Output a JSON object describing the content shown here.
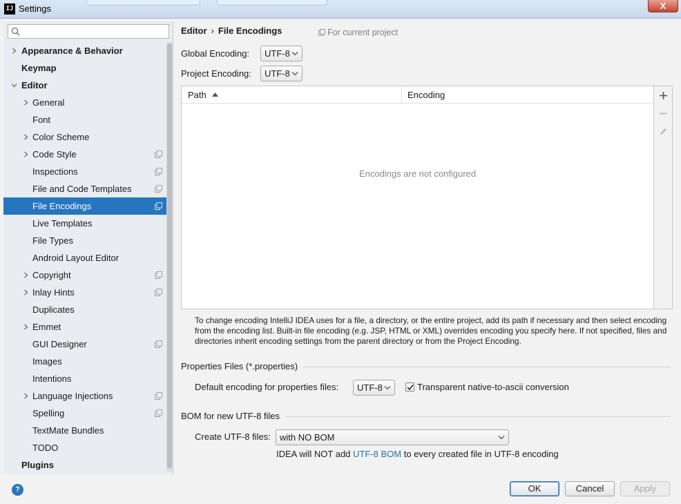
{
  "window": {
    "title": "Settings",
    "app_icon_text": "IJ",
    "close_glyph": "X"
  },
  "search": {
    "placeholder": ""
  },
  "tree": [
    {
      "label": "Appearance & Behavior",
      "level": 0,
      "arrow": "collapsed",
      "project": false,
      "selected": false
    },
    {
      "label": "Keymap",
      "level": 0,
      "arrow": "none",
      "project": false,
      "selected": false
    },
    {
      "label": "Editor",
      "level": 0,
      "arrow": "expanded",
      "project": false,
      "selected": false
    },
    {
      "label": "General",
      "level": 1,
      "arrow": "collapsed",
      "project": false,
      "selected": false
    },
    {
      "label": "Font",
      "level": 1,
      "arrow": "none",
      "project": false,
      "selected": false
    },
    {
      "label": "Color Scheme",
      "level": 1,
      "arrow": "collapsed",
      "project": false,
      "selected": false
    },
    {
      "label": "Code Style",
      "level": 1,
      "arrow": "collapsed",
      "project": true,
      "selected": false
    },
    {
      "label": "Inspections",
      "level": 1,
      "arrow": "none",
      "project": true,
      "selected": false
    },
    {
      "label": "File and Code Templates",
      "level": 1,
      "arrow": "none",
      "project": true,
      "selected": false
    },
    {
      "label": "File Encodings",
      "level": 1,
      "arrow": "none",
      "project": true,
      "selected": true
    },
    {
      "label": "Live Templates",
      "level": 1,
      "arrow": "none",
      "project": false,
      "selected": false
    },
    {
      "label": "File Types",
      "level": 1,
      "arrow": "none",
      "project": false,
      "selected": false
    },
    {
      "label": "Android Layout Editor",
      "level": 1,
      "arrow": "none",
      "project": false,
      "selected": false
    },
    {
      "label": "Copyright",
      "level": 1,
      "arrow": "collapsed",
      "project": true,
      "selected": false
    },
    {
      "label": "Inlay Hints",
      "level": 1,
      "arrow": "collapsed",
      "project": true,
      "selected": false
    },
    {
      "label": "Duplicates",
      "level": 1,
      "arrow": "none",
      "project": false,
      "selected": false
    },
    {
      "label": "Emmet",
      "level": 1,
      "arrow": "collapsed",
      "project": false,
      "selected": false
    },
    {
      "label": "GUI Designer",
      "level": 1,
      "arrow": "none",
      "project": true,
      "selected": false
    },
    {
      "label": "Images",
      "level": 1,
      "arrow": "none",
      "project": false,
      "selected": false
    },
    {
      "label": "Intentions",
      "level": 1,
      "arrow": "none",
      "project": false,
      "selected": false
    },
    {
      "label": "Language Injections",
      "level": 1,
      "arrow": "collapsed",
      "project": true,
      "selected": false
    },
    {
      "label": "Spelling",
      "level": 1,
      "arrow": "none",
      "project": true,
      "selected": false
    },
    {
      "label": "TextMate Bundles",
      "level": 1,
      "arrow": "none",
      "project": false,
      "selected": false
    },
    {
      "label": "TODO",
      "level": 1,
      "arrow": "none",
      "project": false,
      "selected": false
    },
    {
      "label": "Plugins",
      "level": 0,
      "arrow": "none",
      "project": false,
      "selected": false
    }
  ],
  "breadcrumb": {
    "parent": "Editor",
    "separator": "›",
    "current": "File Encodings"
  },
  "scope_note": "For current project",
  "global_encoding": {
    "label": "Global Encoding:",
    "value": "UTF-8"
  },
  "project_encoding": {
    "label": "Project Encoding:",
    "value": "UTF-8"
  },
  "table": {
    "columns": [
      "Path",
      "Encoding"
    ],
    "sort_column": "Path",
    "sort_direction": "ascending",
    "empty_text": "Encodings are not configured",
    "rows": []
  },
  "help_text": "To change encoding IntelliJ IDEA uses for a file, a directory, or the entire project, add its path if necessary and then select encoding from the encoding list. Built-in file encoding (e.g. JSP, HTML or XML) overrides encoding you specify here. If not specified, files and directories inherit encoding settings from the parent directory or from the Project Encoding.",
  "properties": {
    "section_title": "Properties Files (*.properties)",
    "default_label": "Default encoding for properties files:",
    "default_value": "UTF-8",
    "transparent_label": "Transparent native-to-ascii conversion",
    "transparent_checked": true
  },
  "bom": {
    "section_title": "BOM for new UTF-8 files",
    "create_label": "Create UTF-8 files:",
    "create_value": "with NO BOM",
    "note_prefix": "IDEA will NOT add",
    "note_link": "UTF-8 BOM",
    "note_suffix": "to every created file in UTF-8 encoding"
  },
  "buttons": {
    "help": "?",
    "ok": "OK",
    "cancel": "Cancel",
    "apply": "Apply",
    "apply_enabled": false
  },
  "colors": {
    "selection": "#2675bf",
    "link": "#2470b3",
    "panel": "#f2f2f2",
    "sidebar": "#e9ecf0"
  }
}
